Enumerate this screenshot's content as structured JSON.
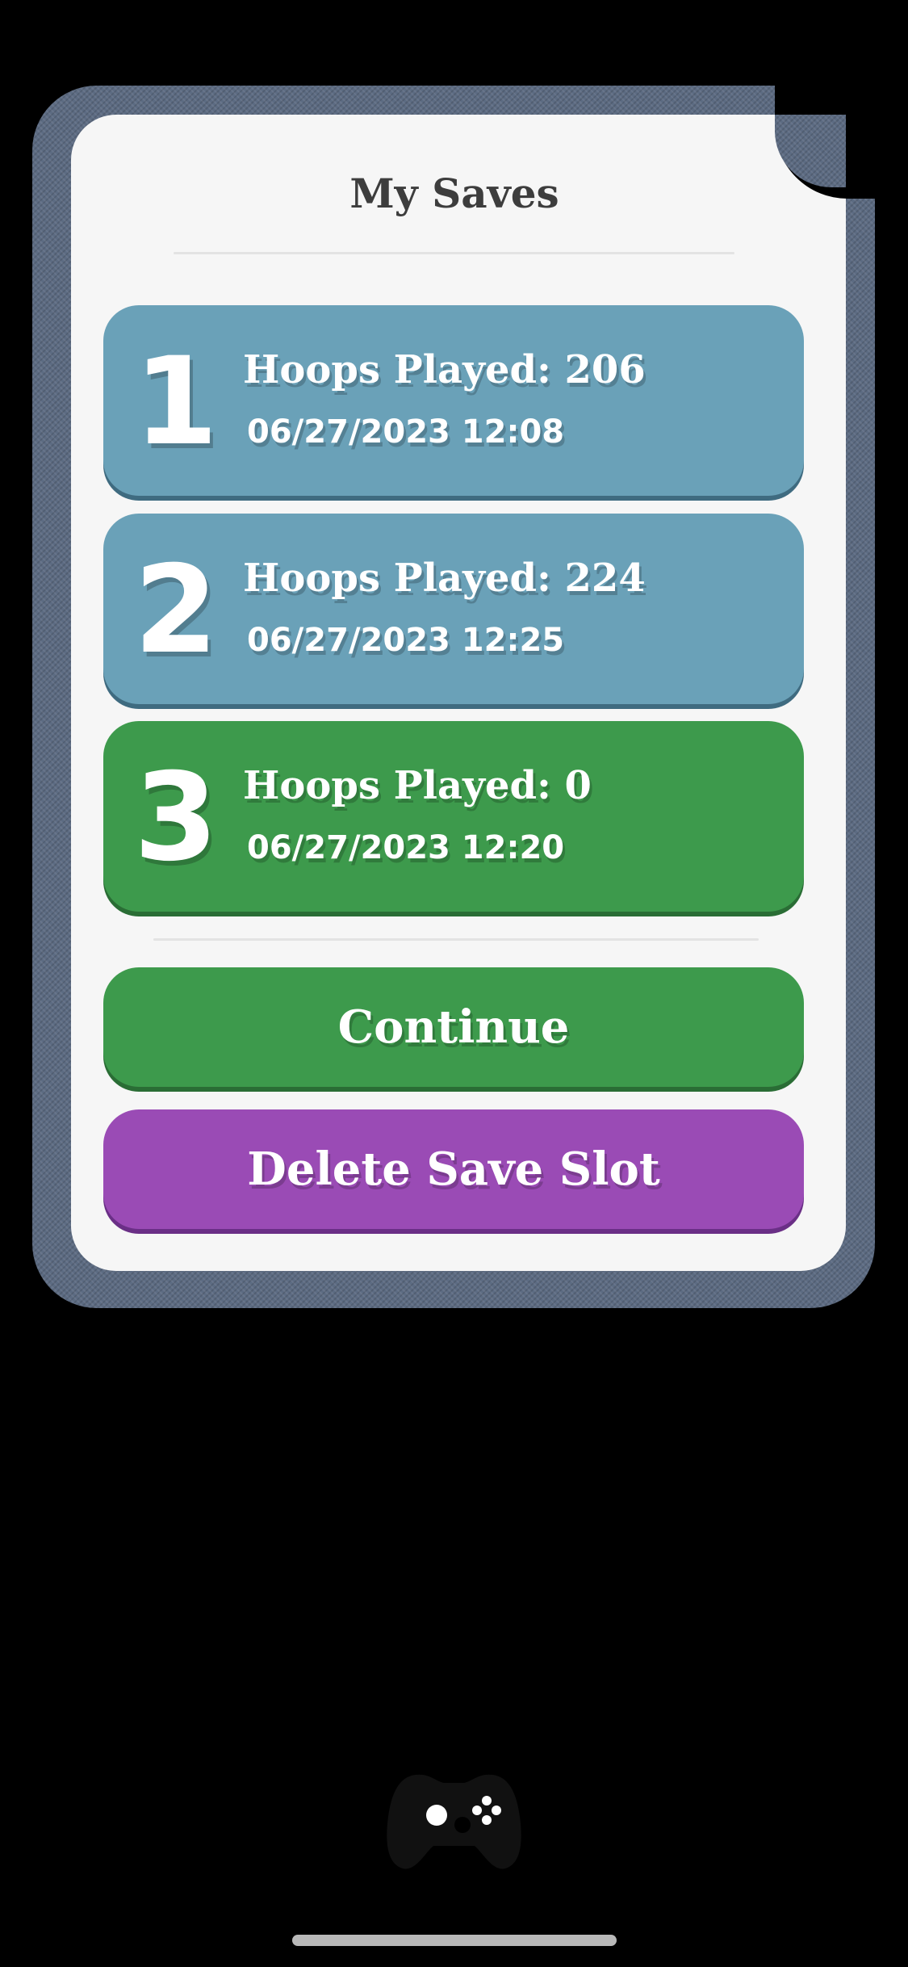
{
  "dialog": {
    "title": "My Saves",
    "slots": [
      {
        "number": "1",
        "hoops": "Hoops Played: 206",
        "date": "06/27/2023 12:08",
        "selected": false
      },
      {
        "number": "2",
        "hoops": "Hoops Played: 224",
        "date": "06/27/2023 12:25",
        "selected": false
      },
      {
        "number": "3",
        "hoops": "Hoops Played: 0",
        "date": "06/27/2023 12:20",
        "selected": true
      }
    ],
    "continue_label": "Continue",
    "delete_label": "Delete Save Slot"
  },
  "colors": {
    "slot_default": "#6aa1b8",
    "slot_selected": "#3d9a4c",
    "continue": "#3d9a4c",
    "delete": "#9a4bb5",
    "frame": "#5c6b82"
  },
  "icons": {
    "bottom": "gamepad-icon"
  }
}
